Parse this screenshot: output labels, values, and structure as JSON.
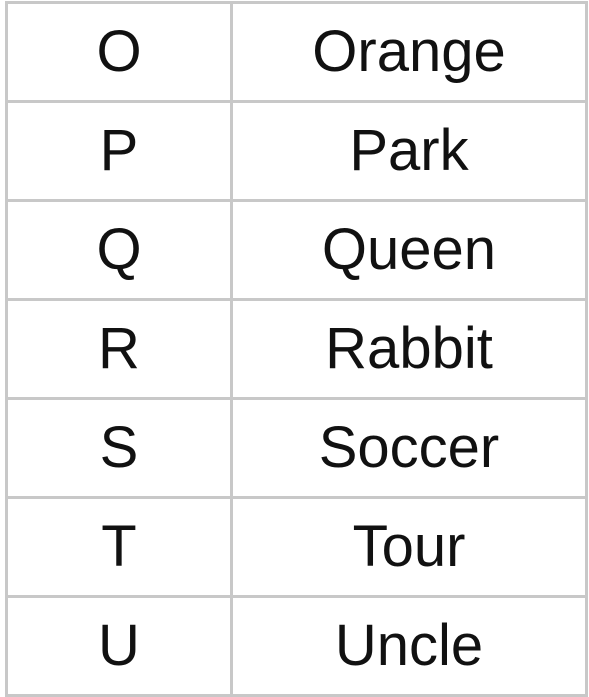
{
  "rows": [
    {
      "letter": "O",
      "word": "Orange"
    },
    {
      "letter": "P",
      "word": "Park"
    },
    {
      "letter": "Q",
      "word": "Queen"
    },
    {
      "letter": "R",
      "word": "Rabbit"
    },
    {
      "letter": "S",
      "word": "Soccer"
    },
    {
      "letter": "T",
      "word": "Tour"
    },
    {
      "letter": "U",
      "word": "Uncle"
    }
  ],
  "colors": {
    "border": "#c8c8c8",
    "text": "#111111",
    "background": "#ffffff"
  }
}
